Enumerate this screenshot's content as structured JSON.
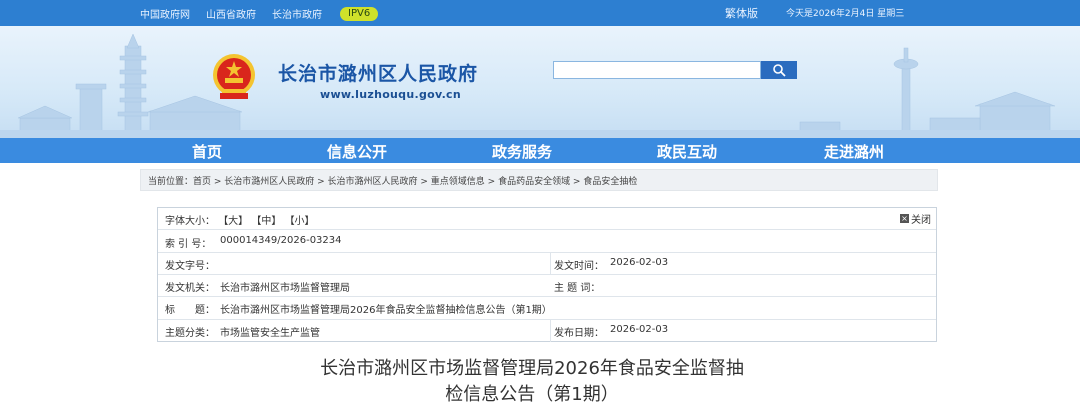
{
  "topbar": {
    "links": [
      "中国政府网",
      "山西省政府",
      "长治市政府"
    ],
    "ipv6": "IPV6",
    "traditional": "繁体版",
    "date": "今天是2026年2月4日 星期三"
  },
  "header": {
    "title": "长治市潞州区人民政府",
    "url": "www.luzhouqu.gov.cn",
    "search_placeholder": ""
  },
  "nav": {
    "items": [
      "首页",
      "信息公开",
      "政务服务",
      "政民互动",
      "走进潞州"
    ]
  },
  "breadcrumb": {
    "label": "当前位置：",
    "path": "首页 > 长治市潞州区人民政府 > 长治市潞州区人民政府 > 重点领域信息 > 食品药品安全领域 > 食品安全抽检"
  },
  "info": {
    "font_size_label": "字体大小：",
    "font_large": "【大】",
    "font_medium": "【中】",
    "font_small": "【小】",
    "close_label": "关闭",
    "index_label": "索 引 号：",
    "index_value": "000014349/2026-03234",
    "doc_no_label": "发文字号：",
    "doc_no_value": "",
    "issue_date_label": "发文时间：",
    "issue_date_value": "2026-02-03",
    "issuer_label": "发文机关：",
    "issuer_value": "长治市潞州区市场监督管理局",
    "subject_words_label": "主 题 词：",
    "subject_words_value": "",
    "title_label": "标　　题：",
    "title_value": "长治市潞州区市场监督管理局2026年食品安全监督抽检信息公告（第1期）",
    "category_label": "主题分类：",
    "category_value": "市场监管安全生产监管",
    "publish_date_label": "发布日期：",
    "publish_date_value": "2026-02-03"
  },
  "article": {
    "title_line1": "长治市潞州区市场监督管理局2026年食品安全监督抽",
    "title_line2": "检信息公告（第1期）"
  },
  "colors": {
    "topbar": "#2d7fd1",
    "nav": "#3a8be0",
    "title_blue": "#1b56a6",
    "ipv6_badge": "#cfe12a"
  }
}
